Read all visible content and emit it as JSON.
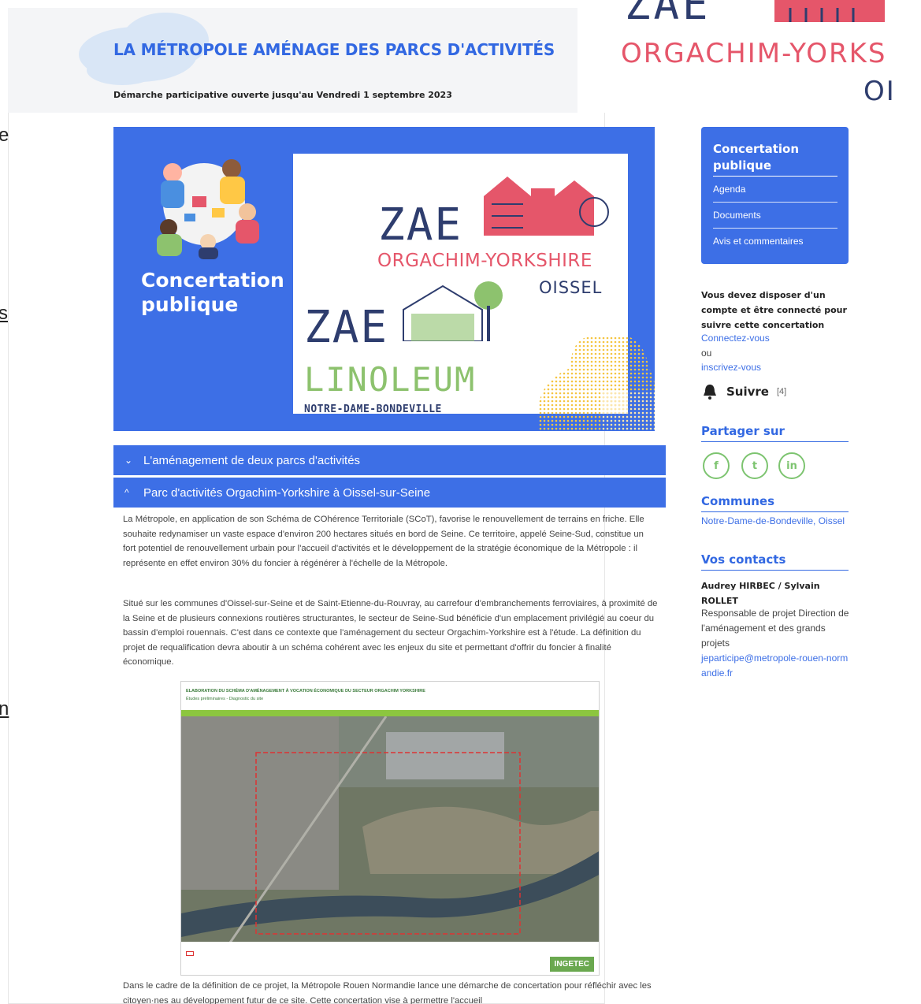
{
  "header": {
    "title": "LA MÉTROPOLE AMÉNAGE DES PARCS D'ACTIVITÉS",
    "subtitle": "Démarche participative ouverte jusqu'au Vendredi 1 septembre 2023"
  },
  "left_fragments": {
    "frag1": "e",
    "frag2": "s",
    "frag3": "n"
  },
  "logo_fragment": {
    "zae": "ZAE",
    "orga": "ORGACHIM-YORKS",
    "oi": "OI"
  },
  "hero": {
    "concertation": "Concertation",
    "publique": "publique",
    "zae1": "ZAE",
    "orga": "ORGACHIM-YORKSHIRE",
    "oissel": "OISSEL",
    "zae2": "ZAE",
    "linoleum": "LINOLEUM",
    "ndb": "NOTRE-DAME-BONDEVILLE"
  },
  "accordion": [
    {
      "label": "L'aménagement de deux parcs d'activités",
      "chevron": "⌄"
    },
    {
      "label": "Parc d'activités Orgachim-Yorkshire à Oissel-sur-Seine",
      "chevron": "^"
    }
  ],
  "paragraphs": [
    "La Métropole, en application de son Schéma de COhérence Territoriale (SCoT), favorise le renouvellement de terrains en friche. Elle souhaite redynamiser un vaste espace d'environ 200 hectares situés en bord de Seine. Ce territoire, appelé Seine-Sud, constitue un fort potentiel de renouvellement urbain pour l'accueil d'activités et le développement de la stratégie économique de la Métropole : il représente en effet environ 30% du foncier à régénérer à l'échelle de la Métropole.",
    "Situé sur les communes d'Oissel-sur-Seine et de Saint-Etienne-du-Rouvray, au carrefour d'embranchements ferroviaires, à proximité de la Seine et de plusieurs connexions routières structurantes, le secteur de Seine-Sud bénéficie d'un emplacement privilégié au coeur du bassin d'emploi rouennais. C'est dans ce contexte que l'aménagement du secteur Orgachim-Yorkshire est à l'étude. La définition du projet de requalification devra aboutir à un schéma cohérent avec les enjeux du site et permettant d'offrir du foncier à finalité économique.",
    "Dans le cadre de la définition de ce projet, la Métropole Rouen Normandie lance une démarche de concertation pour réfléchir avec les citoyen·nes au développement futur de ce site. Cette concertation vise à permettre l'accueil"
  ],
  "map": {
    "title": "ELABORATION DU SCHÉMA D'AMÉNAGEMENT À VOCATION ÉCONOMIQUE DU SECTEUR ORGACHIM YORKSHIRE",
    "subtitle": "Études préliminaires - Diagnostic du site",
    "brand": "INGETEC"
  },
  "sidebar": {
    "box_title": "Concertation publique",
    "links": [
      "Agenda",
      "Documents",
      "Avis et commentaires"
    ],
    "login_note": "Vous devez disposer d'un compte et être connecté pour suivre cette concertation",
    "connect": "Connectez-vous",
    "or": "ou",
    "register": "inscrivez-vous",
    "follow": "Suivre",
    "follow_count": "[4]",
    "share_title": "Partager sur",
    "share_icons": [
      "f",
      "t",
      "in"
    ],
    "communes_title": "Communes",
    "communes": "Notre-Dame-de-Bondeville, Oissel",
    "contacts_title": "Vos contacts",
    "contact_name": "Audrey HIRBEC / Sylvain ROLLET",
    "contact_role": "Responsable de projet Direction de l'aménagement et des grands projets",
    "contact_email": "jeparticipe@metropole-rouen-normandie.fr"
  },
  "colors": {
    "accent_blue": "#3d6fe6",
    "title_blue": "#3268e2",
    "pink": "#e5566a",
    "green": "#7dc470",
    "navy": "#2e3d6e"
  }
}
